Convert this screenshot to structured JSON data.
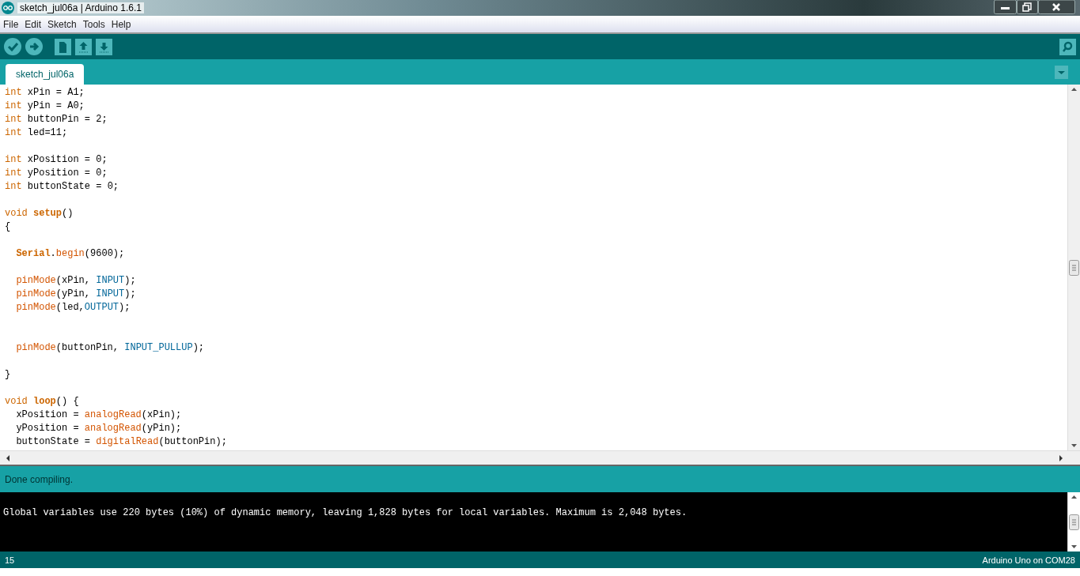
{
  "window": {
    "title": "sketch_jul06a | Arduino 1.6.1"
  },
  "menu": [
    "File",
    "Edit",
    "Sketch",
    "Tools",
    "Help"
  ],
  "toolbar": [
    {
      "kind": "verify"
    },
    {
      "kind": "upload"
    },
    {
      "kind": "new"
    },
    {
      "kind": "open"
    },
    {
      "kind": "save"
    }
  ],
  "tabs": [
    {
      "label": "sketch_jul06a",
      "selected": true
    }
  ],
  "editor": {
    "lines": [
      {
        "kind": "code",
        "indented": false,
        "segments": [
          {
            "kind": "type",
            "text": "int"
          },
          {
            "kind": "plain",
            "text": " xPin = A1;"
          }
        ]
      },
      {
        "kind": "code",
        "indented": false,
        "segments": [
          {
            "kind": "type",
            "text": "int"
          },
          {
            "kind": "plain",
            "text": " yPin = A0;"
          }
        ]
      },
      {
        "kind": "code",
        "indented": false,
        "segments": [
          {
            "kind": "type",
            "text": "int"
          },
          {
            "kind": "plain",
            "text": " buttonPin = 2;"
          }
        ]
      },
      {
        "kind": "code",
        "indented": false,
        "segments": [
          {
            "kind": "type",
            "text": "int"
          },
          {
            "kind": "plain",
            "text": " led=11;"
          }
        ]
      },
      {
        "kind": "blank"
      },
      {
        "kind": "code",
        "indented": false,
        "segments": [
          {
            "kind": "type",
            "text": "int"
          },
          {
            "kind": "plain",
            "text": " xPosition = 0;"
          }
        ]
      },
      {
        "kind": "code",
        "indented": false,
        "segments": [
          {
            "kind": "type",
            "text": "int"
          },
          {
            "kind": "plain",
            "text": " yPosition = 0;"
          }
        ]
      },
      {
        "kind": "code",
        "indented": false,
        "segments": [
          {
            "kind": "type",
            "text": "int"
          },
          {
            "kind": "plain",
            "text": " buttonState = 0;"
          }
        ]
      },
      {
        "kind": "blank"
      },
      {
        "kind": "code",
        "indented": false,
        "segments": [
          {
            "kind": "type",
            "text": "void "
          },
          {
            "kind": "keyword",
            "text": "setup"
          },
          {
            "kind": "plain",
            "text": "()"
          }
        ]
      },
      {
        "kind": "code",
        "indented": false,
        "segments": [
          {
            "kind": "plain",
            "text": "{"
          }
        ]
      },
      {
        "kind": "blank"
      },
      {
        "kind": "code",
        "indented": true,
        "segments": [
          {
            "kind": "keyword",
            "text": "Serial"
          },
          {
            "kind": "plain",
            "text": "."
          },
          {
            "kind": "call",
            "text": "begin"
          },
          {
            "kind": "plain",
            "text": "(9600);"
          }
        ]
      },
      {
        "kind": "blank"
      },
      {
        "kind": "code",
        "indented": true,
        "segments": [
          {
            "kind": "call",
            "text": "pinMode"
          },
          {
            "kind": "plain",
            "text": "(xPin, "
          },
          {
            "kind": "const",
            "text": "INPUT"
          },
          {
            "kind": "plain",
            "text": ");"
          }
        ]
      },
      {
        "kind": "code",
        "indented": true,
        "segments": [
          {
            "kind": "call",
            "text": "pinMode"
          },
          {
            "kind": "plain",
            "text": "(yPin, "
          },
          {
            "kind": "const",
            "text": "INPUT"
          },
          {
            "kind": "plain",
            "text": ");"
          }
        ]
      },
      {
        "kind": "code",
        "indented": true,
        "segments": [
          {
            "kind": "call",
            "text": "pinMode"
          },
          {
            "kind": "plain",
            "text": "(led,"
          },
          {
            "kind": "const",
            "text": "OUTPUT"
          },
          {
            "kind": "plain",
            "text": ");"
          }
        ]
      },
      {
        "kind": "blank"
      },
      {
        "kind": "blank"
      },
      {
        "kind": "code",
        "indented": true,
        "segments": [
          {
            "kind": "call",
            "text": "pinMode"
          },
          {
            "kind": "plain",
            "text": "(buttonPin, "
          },
          {
            "kind": "const",
            "text": "INPUT_PULLUP"
          },
          {
            "kind": "plain",
            "text": ");"
          }
        ]
      },
      {
        "kind": "blank"
      },
      {
        "kind": "code",
        "indented": false,
        "segments": [
          {
            "kind": "plain",
            "text": "}"
          }
        ]
      },
      {
        "kind": "blank"
      },
      {
        "kind": "code",
        "indented": false,
        "segments": [
          {
            "kind": "type",
            "text": "void "
          },
          {
            "kind": "keyword",
            "text": "loop"
          },
          {
            "kind": "plain",
            "text": "() {"
          }
        ]
      },
      {
        "kind": "code",
        "indented": true,
        "segments": [
          {
            "kind": "plain",
            "text": "xPosition = "
          },
          {
            "kind": "call",
            "text": "analogRead"
          },
          {
            "kind": "plain",
            "text": "(xPin);"
          }
        ]
      },
      {
        "kind": "code",
        "indented": true,
        "segments": [
          {
            "kind": "plain",
            "text": "yPosition = "
          },
          {
            "kind": "call",
            "text": "analogRead"
          },
          {
            "kind": "plain",
            "text": "(yPin);"
          }
        ]
      },
      {
        "kind": "code",
        "indented": true,
        "segments": [
          {
            "kind": "plain",
            "text": "buttonState = "
          },
          {
            "kind": "call",
            "text": "digitalRead"
          },
          {
            "kind": "plain",
            "text": "(buttonPin);"
          }
        ]
      }
    ]
  },
  "status": {
    "message": "Done compiling."
  },
  "console": {
    "lines": [
      "Global variables use 220 bytes (10%) of dynamic memory, leaving 1,828 bytes for local variables. Maximum is 2,048 bytes."
    ]
  },
  "footer": {
    "line": "15",
    "board": "Arduino Uno on COM28"
  }
}
